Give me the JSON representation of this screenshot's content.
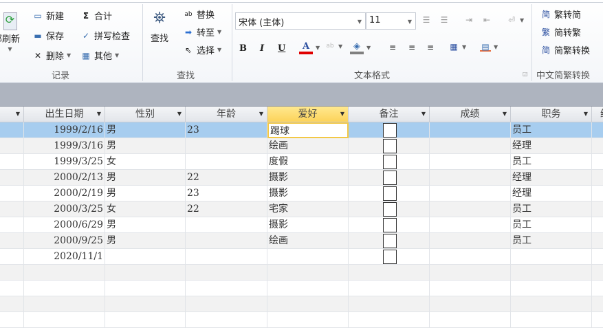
{
  "ribbon": {
    "refresh_all": "部刷新",
    "records": {
      "new": "新建",
      "save": "保存",
      "delete": "删除",
      "sum": "合计",
      "spelling": "拼写检查",
      "more": "其他",
      "label": "记录"
    },
    "find": {
      "find": "查找",
      "replace": "替换",
      "goto": "转至",
      "select": "选择",
      "label": "查找"
    },
    "text_format": {
      "font": "宋体 (主体)",
      "size": "11",
      "bold": "B",
      "italic": "I",
      "underline": "U",
      "font_color_glyph": "A",
      "label": "文本格式",
      "font_color": "#e00000",
      "fill_color": "#808080"
    },
    "chinese": {
      "t2s": "繁转简",
      "s2t": "简转繁",
      "convert": "简繁转换",
      "label": "中文简繁转换"
    }
  },
  "columns": [
    "出生日期",
    "性别",
    "年龄",
    "爱好",
    "备注",
    "成绩",
    "职务",
    "织"
  ],
  "rows": [
    {
      "date": "1999/2/16",
      "gender": "男",
      "age": "23",
      "hobby": "踢球",
      "job": "员工"
    },
    {
      "date": "1999/3/16",
      "gender": "男",
      "age": "",
      "hobby": "绘画",
      "job": "经理"
    },
    {
      "date": "1999/3/25",
      "gender": "女",
      "age": "",
      "hobby": "度假",
      "job": "员工"
    },
    {
      "date": "2000/2/13",
      "gender": "男",
      "age": "22",
      "hobby": "摄影",
      "job": "经理"
    },
    {
      "date": "2000/2/19",
      "gender": "男",
      "age": "23",
      "hobby": "摄影",
      "job": "经理"
    },
    {
      "date": "2000/3/25",
      "gender": "女",
      "age": "22",
      "hobby": "宅家",
      "job": "员工"
    },
    {
      "date": "2000/6/29",
      "gender": "男",
      "age": "",
      "hobby": "摄影",
      "job": "员工"
    },
    {
      "date": "2000/9/25",
      "gender": "男",
      "age": "",
      "hobby": "绘画",
      "job": "员工"
    },
    {
      "date": "2020/11/1",
      "gender": "",
      "age": "",
      "hobby": "",
      "job": ""
    }
  ]
}
